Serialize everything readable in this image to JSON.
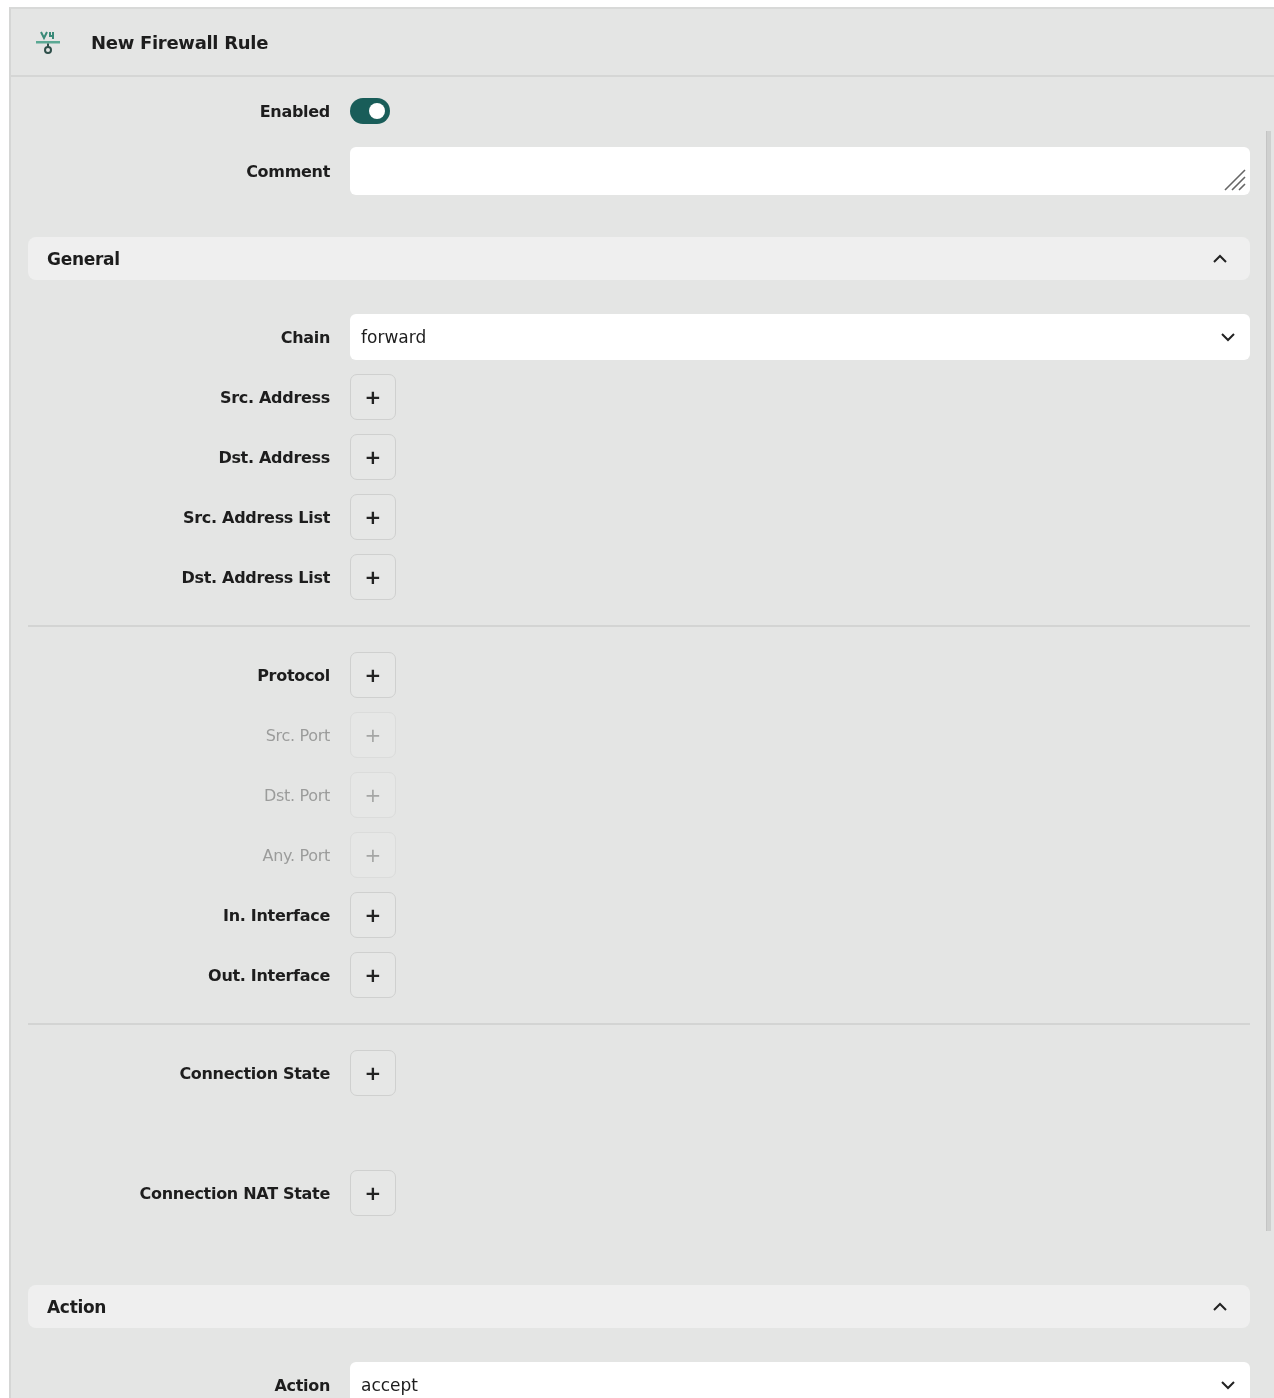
{
  "header": {
    "title": "New Firewall Rule"
  },
  "top_fields": [
    {
      "kind": "toggle",
      "label": "Enabled",
      "on": true
    },
    {
      "kind": "textarea",
      "label": "Comment"
    }
  ],
  "sections": [
    {
      "title": "General",
      "expanded": true,
      "groups": [
        [
          {
            "kind": "select",
            "label": "Chain",
            "value": "forward"
          },
          {
            "kind": "add",
            "label": "Src. Address",
            "button": "+",
            "disabled": false
          },
          {
            "kind": "add",
            "label": "Dst. Address",
            "button": "+",
            "disabled": false
          },
          {
            "kind": "add",
            "label": "Src. Address List",
            "button": "+",
            "disabled": false
          },
          {
            "kind": "add",
            "label": "Dst. Address List",
            "button": "+",
            "disabled": false
          }
        ],
        [
          {
            "kind": "add",
            "label": "Protocol",
            "button": "+",
            "disabled": false
          },
          {
            "kind": "add",
            "label": "Src. Port",
            "button": "+",
            "disabled": true
          },
          {
            "kind": "add",
            "label": "Dst. Port",
            "button": "+",
            "disabled": true
          },
          {
            "kind": "add",
            "label": "Any. Port",
            "button": "+",
            "disabled": true
          },
          {
            "kind": "add",
            "label": "In. Interface",
            "button": "+",
            "disabled": false
          },
          {
            "kind": "add",
            "label": "Out. Interface",
            "button": "+",
            "disabled": false
          }
        ],
        [
          {
            "kind": "add",
            "label": "Connection State",
            "button": "+",
            "disabled": false
          },
          {
            "kind": "add",
            "label": "Connection NAT State",
            "button": "+",
            "disabled": false
          }
        ]
      ]
    },
    {
      "title": "Action",
      "expanded": true,
      "groups": [
        [
          {
            "kind": "select",
            "label": "Action",
            "value": "accept"
          }
        ]
      ]
    }
  ]
}
